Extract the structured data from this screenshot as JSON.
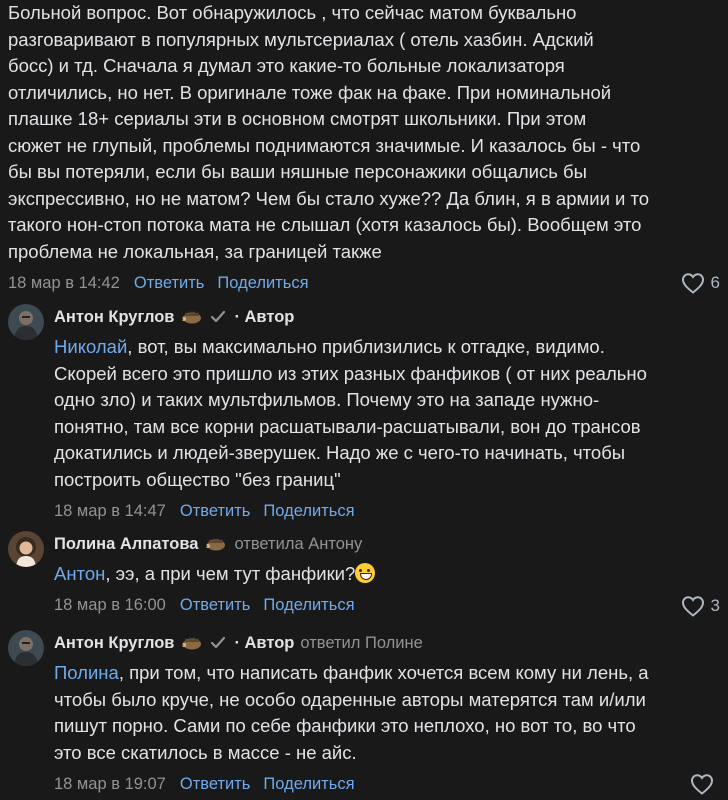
{
  "top_comment": {
    "text": "Больной вопрос. Вот обнаружилось , что сейчас матом буквально\nразговаривают в популярных мультсериалах ( отель хазбин. Адский\nбосс) и тд. Сначала я думал это какие-то больные локализаторя\nотличились, но нет. В оригинале тоже фак на факе. При номинальной\nплашке 18+ сериалы эти в основном смотрят школьники. При этом\nсюжет не глупый, проблемы поднимаются значимые. И казалось бы - что\nбы вы потеряли, если бы ваши няшные персонажики общались бы\nэкспрессивно, но не матом? Чем бы стало хуже?? Да блин, я в армии и то\nтакого нон-стоп потока мата не слышал (хотя казалось бы). Вообщем это\nпроблема не локальная, за границей также",
    "date": "18 мар в 14:42",
    "reply_label": "Ответить",
    "share_label": "Поделиться",
    "likes": "6"
  },
  "replies": [
    {
      "author": "Антон Круглов",
      "verified": true,
      "author_tag": "· Автор",
      "replied_to": "",
      "mention": "Николай",
      "text": ", вот, вы максимально приблизились к отгадке, видимо.\nСкорей всего это пришло из этих разных фанфиков ( от них реально\nодно зло) и таких мультфильмов. Почему это на западе нужно-\nпонятно, там все корни расшатывали-расшатывали, вон до трансов\nдокатились и людей-зверушек. Надо же с чего-то начинать, чтобы\nпостроить общество \"без границ\"",
      "date": "18 мар в 14:47",
      "reply_label": "Ответить",
      "share_label": "Поделиться",
      "likes": ""
    },
    {
      "author": "Полина Алпатова",
      "verified": false,
      "author_tag": "",
      "replied_to": "ответила Антону",
      "mention": "Антон",
      "text": ", ээ, а при чем тут фанфики?",
      "emoji": "grinning-sweat-emoji",
      "date": "18 мар в 16:00",
      "reply_label": "Ответить",
      "share_label": "Поделиться",
      "likes": "3"
    },
    {
      "author": "Антон Круглов",
      "verified": true,
      "author_tag": "· Автор",
      "replied_to": "ответил Полине",
      "mention": "Полина",
      "text": ", при том, что написать фанфик хочется всем кому ни лень, а\nчтобы было круче, не особо одаренные авторы матерятся там и/или\nпишут порно. Сами по себе фанфики это неплохо, но вот то, во что\nэто все скатилось в массе - не айс.",
      "date": "18 мар в 19:07",
      "reply_label": "Ответить",
      "share_label": "Поделиться",
      "likes": ""
    }
  ],
  "colors": {
    "background": "#19191a",
    "text": "#e1e3e6",
    "link": "#71aaeb",
    "muted": "#939393"
  }
}
